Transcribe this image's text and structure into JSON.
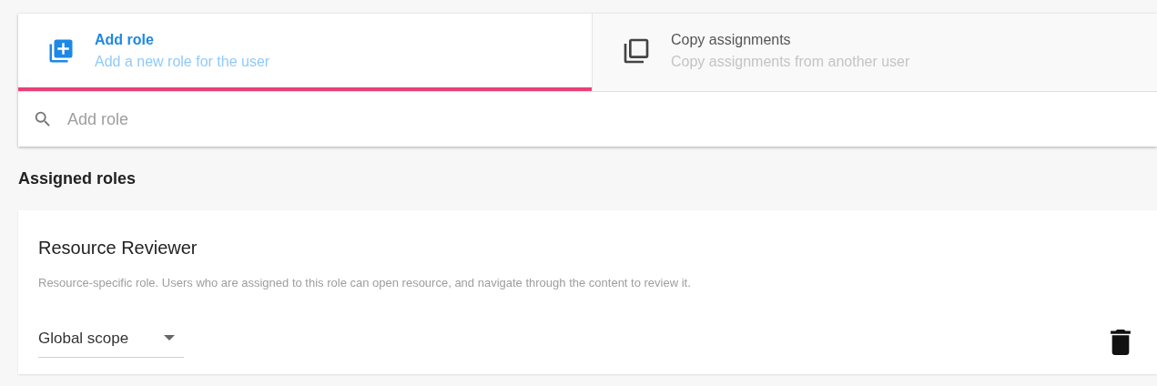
{
  "tabs": [
    {
      "kind": "add",
      "title": "Add role",
      "subtitle": "Add a new role for the user",
      "selected": true
    },
    {
      "kind": "copy",
      "title": "Copy assignments",
      "subtitle": "Copy assignments from another user",
      "selected": false
    }
  ],
  "search": {
    "placeholder": "Add role"
  },
  "section_title": "Assigned roles",
  "roles": [
    {
      "name": "Resource Reviewer",
      "description": "Resource-specific role. Users who are assigned to this role can open resource, and navigate through the content to review it.",
      "scope": "Global scope"
    }
  ]
}
